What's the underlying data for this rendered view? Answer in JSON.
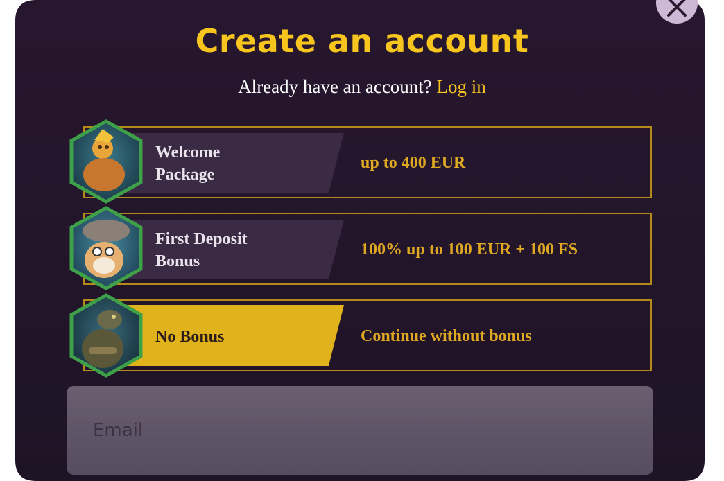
{
  "modal": {
    "title": "Create an account",
    "subtitle": "Already have an account?",
    "login_link": "Log in",
    "close_icon": "close-icon"
  },
  "bonuses": [
    {
      "name_line1": "Welcome",
      "name_line2": "Package",
      "value": "up to 400 EUR",
      "selected": false,
      "icon": "golden-monkey-avatar"
    },
    {
      "name_line1": "First Deposit",
      "name_line2": "Bonus",
      "value": "100% up to 100 EUR + 100 FS",
      "selected": false,
      "icon": "hamster-mushroom-avatar"
    },
    {
      "name_line1": "No Bonus",
      "value": "Continue without bonus",
      "selected": true,
      "icon": "lizard-warrior-avatar"
    }
  ],
  "email": {
    "placeholder": "Email",
    "value": ""
  },
  "colors": {
    "accent": "#f7c51d",
    "background": "#22152a",
    "border": "#b48a1a",
    "hex_border": "#3fa04a"
  }
}
